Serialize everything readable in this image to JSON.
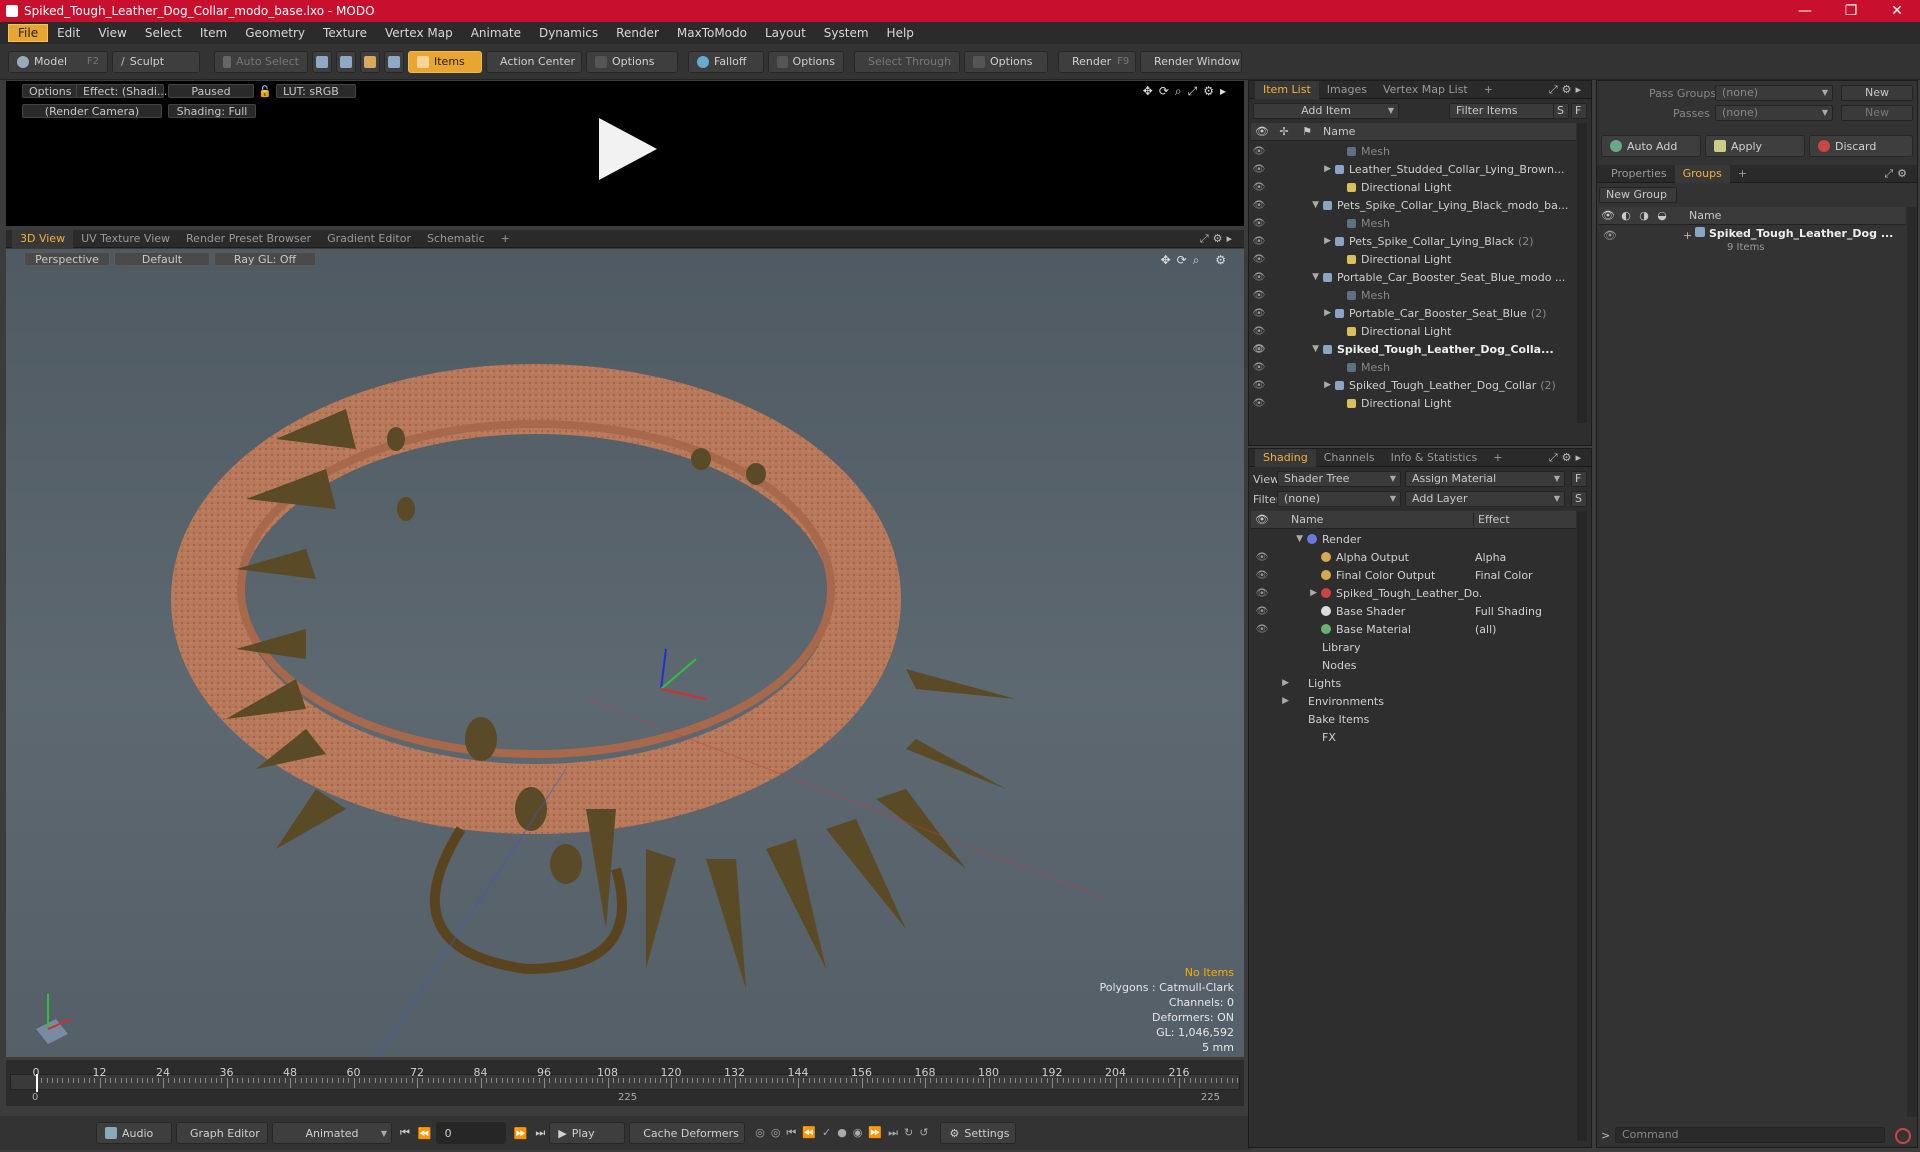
{
  "window": {
    "title": "Spiked_Tough_Leather_Dog_Collar_modo_base.lxo - MODO",
    "controls": [
      "—",
      "❐",
      "✕"
    ]
  },
  "menu": [
    "File",
    "Edit",
    "View",
    "Select",
    "Item",
    "Geometry",
    "Texture",
    "Vertex Map",
    "Animate",
    "Dynamics",
    "Render",
    "MaxToModo",
    "Layout",
    "System",
    "Help"
  ],
  "toolbar": {
    "model": "Model",
    "model_key": "F2",
    "sculpt": "Sculpt",
    "auto_select": "Auto Select",
    "items": "Items",
    "action_center": "Action Center",
    "options1": "Options",
    "falloff": "Falloff",
    "options2": "Options",
    "select_through": "Select Through",
    "options3": "Options",
    "render": "Render",
    "render_key": "F9",
    "render_window": "Render Window"
  },
  "render_view": {
    "options": "Options",
    "effect": "Effect: (Shadi...",
    "paused": "Paused",
    "lut": "LUT: sRGB",
    "camera": "(Render Camera)",
    "shading": "Shading: Full"
  },
  "viewport_tabs": [
    "3D View",
    "UV Texture View",
    "Render Preset Browser",
    "Gradient Editor",
    "Schematic",
    "+"
  ],
  "viewport": {
    "perspective": "Perspective",
    "default": "Default",
    "raygl": "Ray GL: Off",
    "hud": {
      "no_items": "No Items",
      "polygons": "Polygons : Catmull-Clark",
      "channels": "Channels: 0",
      "deformers": "Deformers: ON",
      "gl": "GL: 1,046,592",
      "scale": "5 mm"
    }
  },
  "timeline": {
    "ticks": [
      "0",
      "12",
      "24",
      "36",
      "48",
      "60",
      "72",
      "84",
      "96",
      "108",
      "120",
      "132",
      "144",
      "156",
      "168",
      "180",
      "192",
      "204",
      "216"
    ],
    "start": "0",
    "mid": "225",
    "end": "225"
  },
  "bottom": {
    "audio": "Audio",
    "graph_editor": "Graph Editor",
    "animated": "Animated",
    "frame": "0",
    "play": "Play",
    "cache": "Cache Deformers",
    "settings": "Settings"
  },
  "item_list": {
    "tabs": [
      "Item List",
      "Images",
      "Vertex Map List",
      "+"
    ],
    "add_item": "Add Item",
    "filter": "Filter Items",
    "s": "S",
    "f": "F",
    "col_name": "Name",
    "rows": [
      {
        "label": "Mesh",
        "style": "dim",
        "indent": 3
      },
      {
        "label": "Leather_Studded_Collar_Lying_Brown...",
        "style": "",
        "indent": 2,
        "arrow": "▶"
      },
      {
        "label": "Directional Light",
        "style": "",
        "indent": 3
      },
      {
        "label": "Pets_Spike_Collar_Lying_Black_modo_ba...",
        "style": "",
        "indent": 1,
        "arrow": "▼"
      },
      {
        "label": "Mesh",
        "style": "dim",
        "indent": 3
      },
      {
        "label": "Pets_Spike_Collar_Lying_Black",
        "count": "(2)",
        "style": "",
        "indent": 2,
        "arrow": "▶"
      },
      {
        "label": "Directional Light",
        "style": "",
        "indent": 3
      },
      {
        "label": "Portable_Car_Booster_Seat_Blue_modo ...",
        "style": "",
        "indent": 1,
        "arrow": "▼"
      },
      {
        "label": "Mesh",
        "style": "dim",
        "indent": 3
      },
      {
        "label": "Portable_Car_Booster_Seat_Blue",
        "count": "(2)",
        "style": "",
        "indent": 2,
        "arrow": "▶"
      },
      {
        "label": "Directional Light",
        "style": "",
        "indent": 3
      },
      {
        "label": "Spiked_Tough_Leather_Dog_Colla...",
        "style": "bold",
        "indent": 1,
        "arrow": "▼"
      },
      {
        "label": "Mesh",
        "style": "dim",
        "indent": 3
      },
      {
        "label": "Spiked_Tough_Leather_Dog_Collar",
        "count": "(2)",
        "style": "",
        "indent": 2,
        "arrow": "▶"
      },
      {
        "label": "Directional Light",
        "style": "",
        "indent": 3
      }
    ]
  },
  "shading": {
    "tabs": [
      "Shading",
      "Channels",
      "Info & Statistics",
      "+"
    ],
    "view_label": "View",
    "view_value": "Shader Tree",
    "assign_material": "Assign Material",
    "filter_label": "Filter",
    "filter_value": "(none)",
    "add_layer": "Add Layer",
    "f": "F",
    "s": "S",
    "col_name": "Name",
    "col_effect": "Effect",
    "rows": [
      {
        "label": "Render",
        "effect": "",
        "indent": 0,
        "arrow": "▼",
        "eye": false
      },
      {
        "label": "Alpha Output",
        "effect": "Alpha",
        "indent": 1,
        "eye": true
      },
      {
        "label": "Final Color Output",
        "effect": "Final Color",
        "indent": 1,
        "eye": true
      },
      {
        "label": "Spiked_Tough_Leather_Do...",
        "effect": "",
        "indent": 1,
        "arrow": "▶",
        "eye": true
      },
      {
        "label": "Base Shader",
        "effect": "Full Shading",
        "indent": 1,
        "eye": true
      },
      {
        "label": "Base Material",
        "effect": "(all)",
        "indent": 1,
        "eye": true
      },
      {
        "label": "Library",
        "effect": "",
        "indent": 0,
        "eye": false
      },
      {
        "label": "Nodes",
        "effect": "",
        "indent": 0,
        "eye": false
      },
      {
        "label": "Lights",
        "effect": "",
        "indent": -1,
        "arrow": "▶",
        "eye": false
      },
      {
        "label": "Environments",
        "effect": "",
        "indent": -1,
        "arrow": "▶",
        "eye": false
      },
      {
        "label": "Bake Items",
        "effect": "",
        "indent": -1,
        "eye": false
      },
      {
        "label": "FX",
        "effect": "",
        "indent": 0,
        "eye": false
      }
    ]
  },
  "groups": {
    "pass_groups": "Pass Groups",
    "pass_groups_value": "(none)",
    "new1": "New",
    "passes": "Passes",
    "passes_value": "(none)",
    "new2": "New",
    "auto_add": "Auto Add",
    "apply": "Apply",
    "discard": "Discard",
    "tabs": [
      "Properties",
      "Groups",
      "+"
    ],
    "new_group": "New Group",
    "col_name": "Name",
    "group_name": "Spiked_Tough_Leather_Dog ...",
    "group_count": "9 Items",
    "command": "Command"
  },
  "colors": {
    "accent": "#e8a530",
    "title": "#c8102e"
  }
}
